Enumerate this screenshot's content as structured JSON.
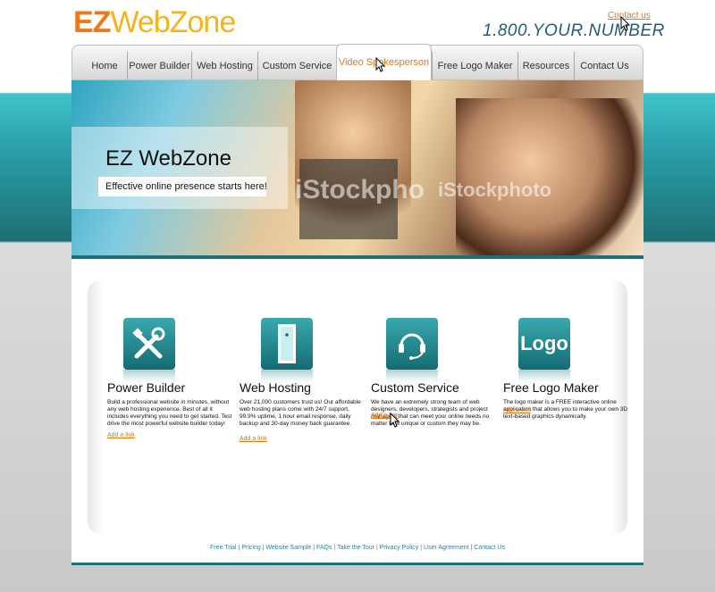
{
  "header": {
    "logo_ez": "EZ",
    "logo_rest": "WebZone",
    "contact_link": "Contact us",
    "phone": "1.800.YOUR.NUMBER"
  },
  "nav": {
    "tabs": [
      {
        "label": "Home"
      },
      {
        "label": "Power Builder"
      },
      {
        "label": "Web Hosting"
      },
      {
        "label": "Custom Service"
      },
      {
        "label": "Video Spokesperson"
      },
      {
        "label": "Free Logo Maker"
      },
      {
        "label": "Resources"
      },
      {
        "label": "Contact Us"
      }
    ],
    "active_index": 4
  },
  "hero": {
    "title": "EZ WebZone",
    "subtitle": "Effective online presence starts here!",
    "watermark1": "iStockpho",
    "watermark2": "iStockphoto"
  },
  "features": [
    {
      "title": "Power Builder",
      "icon": "tools-icon",
      "description": "Build a professional website in minutes, without any web hosting experience. Best of all it includes everything you need to get started.  Test drive the most powerful website builder today!",
      "link": "Add a link"
    },
    {
      "title": "Web Hosting",
      "icon": "server-icon",
      "description": "Over 21,000 customers trust us!  Our affordable web hosting plans come with 24/7 support, 99.9% uptime, 1 hour email response, daily backup and 30-day money back guarantee.",
      "link": "Add a link"
    },
    {
      "title": "Custom Service",
      "icon": "headset-icon",
      "description": "We have an extremely strong team of web designers, developers, strategists and project managers that can meet your online needs no matter how unique or custom they may be.",
      "link": "Add a link"
    },
    {
      "title": "Free Logo Maker",
      "icon": "logo-icon",
      "icon_text": "Logo",
      "description": "The logo maker is a FREE interactive online application that allows you to make your own 3D text-based graphics dynamically.",
      "link": "Add a link"
    }
  ],
  "footer": {
    "links": [
      "Free Trial",
      "Pricing",
      "Website Sample",
      "FAQs",
      "Take the Tour",
      "Privacy Policy",
      "User Agreement",
      "Contact Us"
    ],
    "separator": " | "
  },
  "colors": {
    "accent_orange": "#e0781a",
    "teal": "#1e6f7a",
    "link_blue": "#2b82a6"
  }
}
